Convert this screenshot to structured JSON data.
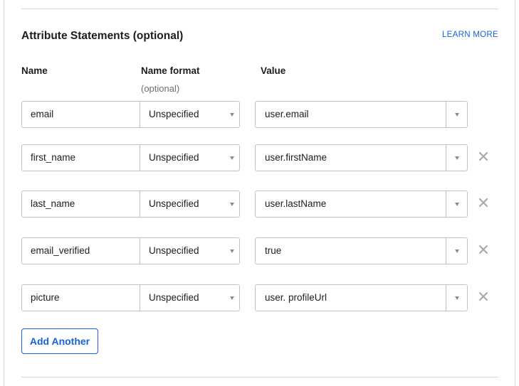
{
  "section": {
    "title": "Attribute Statements (optional)",
    "learn_more": "LEARN MORE"
  },
  "columns": {
    "name": "Name",
    "name_format": "Name format",
    "name_format_sub": "(optional)",
    "value": "Value"
  },
  "rows": [
    {
      "name": "email",
      "format": "Unspecified",
      "value": "user.email",
      "removable": false
    },
    {
      "name": "first_name",
      "format": "Unspecified",
      "value": "user.firstName",
      "removable": true
    },
    {
      "name": "last_name",
      "format": "Unspecified",
      "value": "user.lastName",
      "removable": true
    },
    {
      "name": "email_verified",
      "format": "Unspecified",
      "value": "true",
      "removable": true
    },
    {
      "name": "picture",
      "format": "Unspecified",
      "value": "user. profileUrl",
      "removable": true
    }
  ],
  "add_button": "Add Another",
  "colors": {
    "accent": "#1662dd",
    "border": "#c1c1c8",
    "text": "#1d1d21",
    "muted": "#6e6e78"
  }
}
